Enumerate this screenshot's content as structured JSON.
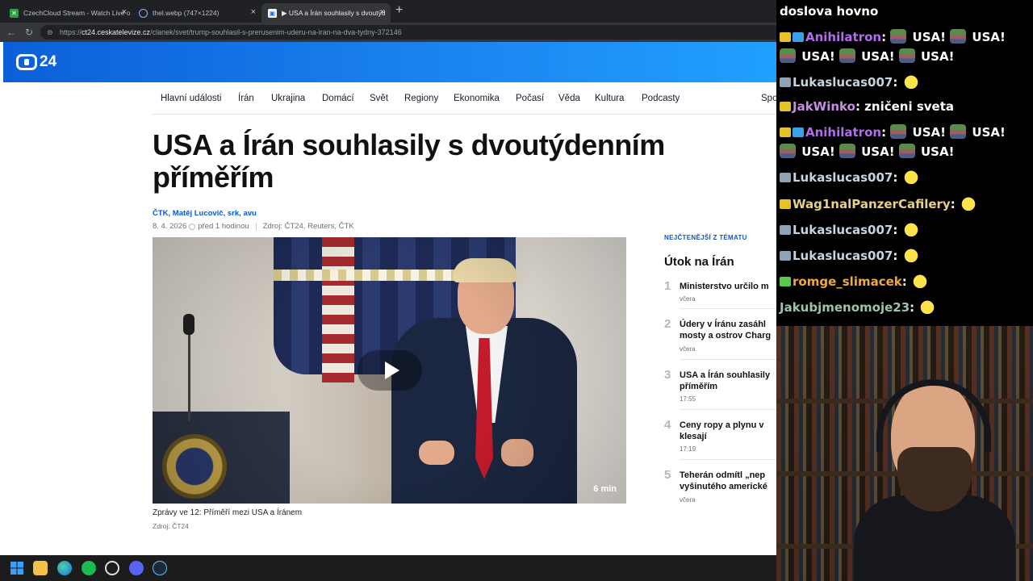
{
  "browser": {
    "tabs": [
      {
        "title": "CzechCloud Stream - Watch Live o",
        "active": false,
        "icon_color": "#2ea043"
      },
      {
        "title": "thel.webp (747×1224)",
        "active": false,
        "icon_color": "#8ab4f8"
      },
      {
        "title": "▶ USA a Írán souhlasily s dvoutýd",
        "active": true,
        "icon_color": "#1b73e8"
      }
    ],
    "url_prefix": "https://",
    "url_host": "ct24.ceskatelevize.cz",
    "url_path": "/clanek/svet/trump-souhlasil-s-prerusenim-uderu-na-iran-na-dva-tydny-372146"
  },
  "site": {
    "logo_text": "24",
    "nav": [
      "Hlavní události",
      "Írán",
      "Ukrajina",
      "Domácí",
      "Svět",
      "Regiony",
      "Ekonomika",
      "Počasí",
      "Věda",
      "Kultura",
      "Podcasty",
      "Spo"
    ]
  },
  "article": {
    "headline": "USA a Írán souhlasily s dvoutýdenním příměřím",
    "byline": "ČTK, Matěj Lucovič, srk, avu",
    "date": "8. 4. 2026",
    "time_ago": "před 1 hodinou",
    "source_label": "Zdroj: ČT24, Reuters, ČTK",
    "video_duration": "6 min",
    "caption": "Zprávy ve 12: Příměří mezi USA a Íránem",
    "caption_source": "Zdroj: ČT24"
  },
  "sidebar": {
    "kicker": "NEJČTENĚJŠÍ Z TÉMATU",
    "title": "Útok na Írán",
    "items": [
      {
        "num": "1",
        "title": [
          "Ministerstvo určilo m"
        ],
        "when": "včera"
      },
      {
        "num": "2",
        "title": [
          "Údery v Íránu zasáhl",
          "mosty a ostrov Charg"
        ],
        "when": "včera"
      },
      {
        "num": "3",
        "title": [
          "USA a Írán souhlasily",
          "příměřím"
        ],
        "when": "17:55"
      },
      {
        "num": "4",
        "title": [
          "Ceny ropy a plynu v",
          "klesají"
        ],
        "when": "17:19"
      },
      {
        "num": "5",
        "title": [
          "Teherán odmítl „nep",
          "vyšinutého americké"
        ],
        "when": "včera"
      }
    ]
  },
  "chat": {
    "messages": [
      {
        "user": "",
        "color": "#ffffff",
        "text": "doslova hovno",
        "badges": []
      },
      {
        "user": "Anihilatron",
        "color": "#b06ee8",
        "text": "USA! USA!",
        "text2": "USA! USA! USA!",
        "badges": [
          "#e6c229",
          "#3aa0e8"
        ],
        "emotes": true
      },
      {
        "user": "Lukaslucas007",
        "color": "#c7d4de",
        "text": "",
        "badges": [
          "#8fa3b5"
        ],
        "duck": true
      },
      {
        "user": "JakWinko",
        "color": "#c78ee8",
        "text": "zničeni sveta",
        "badges": [
          "#e6c229"
        ]
      },
      {
        "user": "Anihilatron",
        "color": "#b06ee8",
        "text": "USA! USA!",
        "text2": "USA! USA! USA!",
        "badges": [
          "#e6c229",
          "#3aa0e8"
        ],
        "emotes": true
      },
      {
        "user": "Lukaslucas007",
        "color": "#c7d4de",
        "text": "",
        "badges": [
          "#8fa3b5"
        ],
        "duck": true
      },
      {
        "user": "Wag1nalPanzerCafilery",
        "color": "#e8d08a",
        "text": "",
        "badges": [
          "#e6c229"
        ],
        "duck": true
      },
      {
        "user": "Lukaslucas007",
        "color": "#c7d4de",
        "text": "",
        "badges": [
          "#8fa3b5"
        ],
        "duck": true
      },
      {
        "user": "Lukaslucas007",
        "color": "#c7d4de",
        "text": "",
        "badges": [
          "#8fa3b5"
        ],
        "duck": true
      },
      {
        "user": "romge_slimacek",
        "color": "#f0a840",
        "text": "",
        "badges": [
          "#5ac84a"
        ],
        "duck": true
      },
      {
        "user": "Jakubjmenomoje23",
        "color": "#9ec4a8",
        "text": "",
        "badges": [],
        "duck": true
      }
    ]
  },
  "taskbar": {
    "icons": [
      "windows-start",
      "file-explorer",
      "edge",
      "spotify",
      "obs",
      "discord",
      "steam"
    ]
  }
}
